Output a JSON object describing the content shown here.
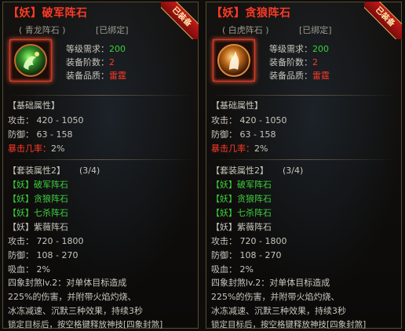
{
  "panels": [
    {
      "title": "【妖】破军阵石",
      "sub_name": "( 青龙阵石 )",
      "bind_state": "[已绑定]",
      "equipped_badge": "已装备",
      "icon": "green-dragon-orb-icon",
      "requirements": [
        {
          "label": "等级需求：",
          "value": "200",
          "color": "green"
        },
        {
          "label": "装备阶数：",
          "value": "2",
          "color": "red"
        },
        {
          "label": "装备品质：",
          "value": "雷霆",
          "color": "red"
        }
      ],
      "base_header": "【基础属性】",
      "base_stats": [
        {
          "text": "攻击：  420 - 1050",
          "color": "white"
        },
        {
          "text": "防御：  63 - 158",
          "color": "white"
        },
        {
          "label": "暴击几率：",
          "value": "2%"
        }
      ],
      "set_header": "【套装属性2】",
      "set_count": "(3/4)",
      "set_items": [
        {
          "text": "【妖】破军阵石",
          "color": "green"
        },
        {
          "text": "【妖】贪狼阵石",
          "color": "green"
        },
        {
          "text": "【妖】七杀阵石",
          "color": "green"
        },
        {
          "text": "【妖】紫薇阵石",
          "color": "white"
        }
      ],
      "set_stats": [
        "攻击：  720 - 1800",
        "防御：  108 - 270",
        "吸血：  2%"
      ],
      "skill_lines": [
        "四象封煞lv.2：对单体目标造成",
        "225%的伤害，并附带火焰灼烧、",
        "冰冻减速、沉默三种效果，持续3秒",
        "锁定目标后，按空格键释放神技[四象封煞]"
      ]
    },
    {
      "title": "【妖】贪狼阵石",
      "sub_name": "( 白虎阵石 )",
      "bind_state": "[已绑定]",
      "equipped_badge": "已装备",
      "icon": "white-tiger-orb-icon",
      "requirements": [
        {
          "label": "等级需求：",
          "value": "200",
          "color": "green"
        },
        {
          "label": "装备阶数：",
          "value": "2",
          "color": "red"
        },
        {
          "label": "装备品质：",
          "value": "雷霆",
          "color": "red"
        }
      ],
      "base_header": "【基础属性】",
      "base_stats": [
        {
          "text": "攻击：  420 - 1050",
          "color": "white"
        },
        {
          "text": "防御：  63 - 158",
          "color": "white"
        },
        {
          "label": "暴击几率：",
          "value": "2%"
        }
      ],
      "set_header": "【套装属性2】",
      "set_count": "(3/4)",
      "set_items": [
        {
          "text": "【妖】破军阵石",
          "color": "green"
        },
        {
          "text": "【妖】贪狼阵石",
          "color": "green"
        },
        {
          "text": "【妖】七杀阵石",
          "color": "green"
        },
        {
          "text": "【妖】紫薇阵石",
          "color": "white"
        }
      ],
      "set_stats": [
        "攻击：  720 - 1800",
        "防御：  108 - 270",
        "吸血：  2%"
      ],
      "skill_lines": [
        "四象封煞lv.2：对单体目标造成",
        "225%的伤害，并附带火焰灼烧、",
        "冰冻减速、沉默三种效果，持续3秒",
        "锁定目标后，按空格键释放神技[四象封煞]"
      ]
    }
  ],
  "colors": {
    "accent_red": "#ff3a26",
    "set_green": "#3ccf3c",
    "border_gold": "#5a4c30"
  }
}
